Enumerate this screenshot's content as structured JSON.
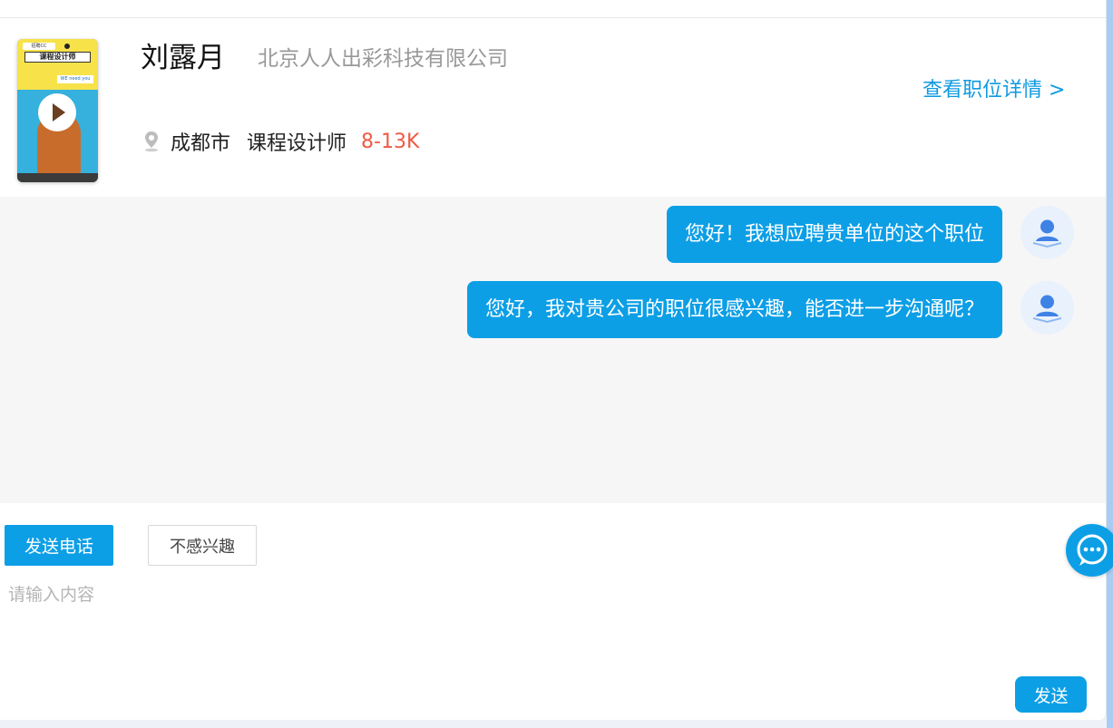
{
  "header": {
    "thumb": {
      "tag": "招聘CC",
      "title": "课程设计师",
      "badge": "WE need you"
    },
    "name": "刘露月",
    "company": "北京人人出彩科技有限公司",
    "detail_link": "查看职位详情 >",
    "city": "成都市",
    "job_title": "课程设计师",
    "salary": "8-13K"
  },
  "chat": {
    "messages": [
      {
        "text": "您好！我想应聘贵单位的这个职位"
      },
      {
        "text": "您好，我对贵公司的职位很感兴趣，能否进一步沟通呢？"
      }
    ]
  },
  "actions": {
    "call_label": "发送电话",
    "not_interested_label": "不感兴趣",
    "input_placeholder": "请输入内容",
    "send_label": "发送"
  },
  "colors": {
    "accent": "#0d9fe6",
    "salary": "#ef5a44",
    "chat_bg": "#f6f6f6"
  },
  "icons": {
    "location": "location-pin-icon",
    "avatar": "user-avatar-icon",
    "float": "chat-bubble-icon",
    "play": "play-icon"
  }
}
